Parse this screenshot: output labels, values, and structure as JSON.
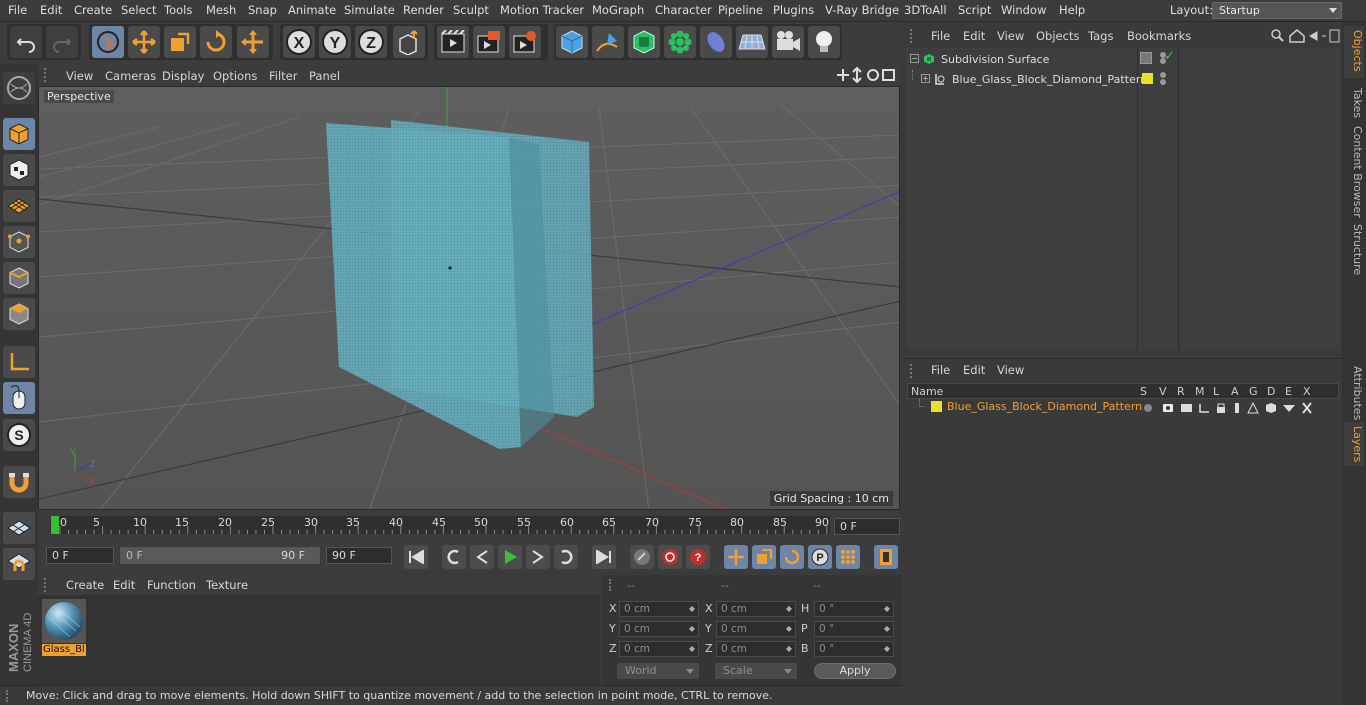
{
  "menu": [
    "File",
    "Edit",
    "Create",
    "Select",
    "Tools",
    "Mesh",
    "Snap",
    "Animate",
    "Simulate",
    "Render",
    "Sculpt",
    "Motion Tracker",
    "MoGraph",
    "Character",
    "Pipeline",
    "Plugins",
    "V-Ray Bridge",
    "3DToAll",
    "Script",
    "Window",
    "Help"
  ],
  "layout": {
    "label": "Layout:",
    "value": "Startup"
  },
  "viewport": {
    "menu": [
      "View",
      "Cameras",
      "Display",
      "Options",
      "Filter",
      "Panel"
    ],
    "camera_label": "Perspective",
    "grid_spacing": "Grid Spacing : 10 cm"
  },
  "timeline": {
    "ticks": [
      "0",
      "5",
      "10",
      "15",
      "20",
      "25",
      "30",
      "35",
      "40",
      "45",
      "50",
      "55",
      "60",
      "65",
      "70",
      "75",
      "80",
      "85",
      "90"
    ],
    "current_frame": "0 F"
  },
  "transport": {
    "start_field": "0 F",
    "range_start": "0 F",
    "range_end": "90 F",
    "end_field": "90 F"
  },
  "material_manager": {
    "menu": [
      "Create",
      "Edit",
      "Function",
      "Texture"
    ],
    "materials": [
      {
        "label": "Glass_Bl"
      }
    ]
  },
  "coordinates": {
    "headers": [
      "--",
      "--",
      "--"
    ],
    "rows": [
      {
        "l1": "X",
        "v1": "0 cm",
        "l2": "X",
        "v2": "0 cm",
        "l3": "H",
        "v3": "0 °"
      },
      {
        "l1": "Y",
        "v1": "0 cm",
        "l2": "Y",
        "v2": "0 cm",
        "l3": "P",
        "v3": "0 °"
      },
      {
        "l1": "Z",
        "v1": "0 cm",
        "l2": "Z",
        "v2": "0 cm",
        "l3": "B",
        "v3": "0 °"
      }
    ],
    "mode": "World",
    "mode2": "Scale",
    "apply": "Apply"
  },
  "object_manager": {
    "menu": [
      "File",
      "Edit",
      "View",
      "Objects",
      "Tags",
      "Bookmarks"
    ],
    "objects": [
      {
        "name": "Subdivision Surface"
      },
      {
        "name": "Blue_Glass_Block_Diamond_Pattern"
      }
    ]
  },
  "layer_manager": {
    "menu": [
      "File",
      "Edit",
      "View"
    ],
    "columns": [
      "Name",
      "S",
      "V",
      "R",
      "M",
      "L",
      "A",
      "G",
      "D",
      "E",
      "X"
    ],
    "layers": [
      {
        "name": "Blue_Glass_Block_Diamond_Pattern",
        "color": "#e8e02a"
      }
    ]
  },
  "right_tabs": [
    "Objects",
    "Takes",
    "Content Browser",
    "Structure",
    "Attributes",
    "Layers"
  ],
  "status": "Move: Click and drag to move elements. Hold down SHIFT to quantize movement / add to the selection in point mode, CTRL to remove.",
  "brand": {
    "line1": "MAXON",
    "line2": "CINEMA 4D"
  },
  "colors": {
    "accent_selected": "#6d86a8",
    "layer_text": "#f0a030",
    "glass": "#5fb6c8"
  },
  "toolbar_icons": [
    "undo-icon",
    "redo-icon",
    "live-selection-icon",
    "move-icon",
    "scale-icon",
    "rotate-icon",
    "transform-icon",
    "x-axis-icon",
    "y-axis-icon",
    "z-axis-icon",
    "coordinate-system-icon",
    "render-view-icon",
    "render-picture-viewer-icon",
    "render-settings-icon",
    "cube-icon",
    "pen-icon",
    "subdivision-icon",
    "mograph-cloner-icon",
    "deformer-icon",
    "floor-icon",
    "camera-icon",
    "light-icon"
  ]
}
